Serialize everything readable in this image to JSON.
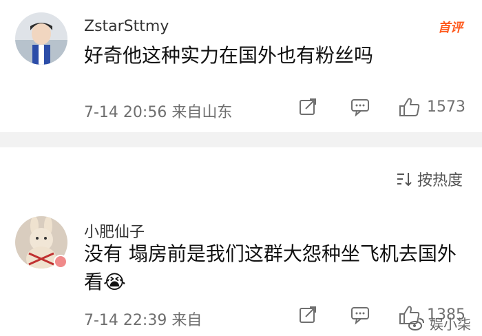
{
  "post1": {
    "username": "ZstarSttmy",
    "badge": "首评",
    "content": "好奇他这种实力在国外也有粉丝吗",
    "meta": "7-14 20:56  来自山东",
    "likes": "1573"
  },
  "sort": {
    "label": "按热度"
  },
  "post2": {
    "username": "小肥仙子",
    "content": "没有 塌房前是我们这群大怨种坐飞机去国外看😭",
    "meta": "7-14 22:39  来自",
    "likes": "1385"
  },
  "watermark": {
    "text": "娱小柒"
  },
  "icons": {
    "share": "share-icon",
    "comment": "comment-icon",
    "like": "like-icon",
    "sort": "sort-icon",
    "weibo": "weibo-icon"
  }
}
